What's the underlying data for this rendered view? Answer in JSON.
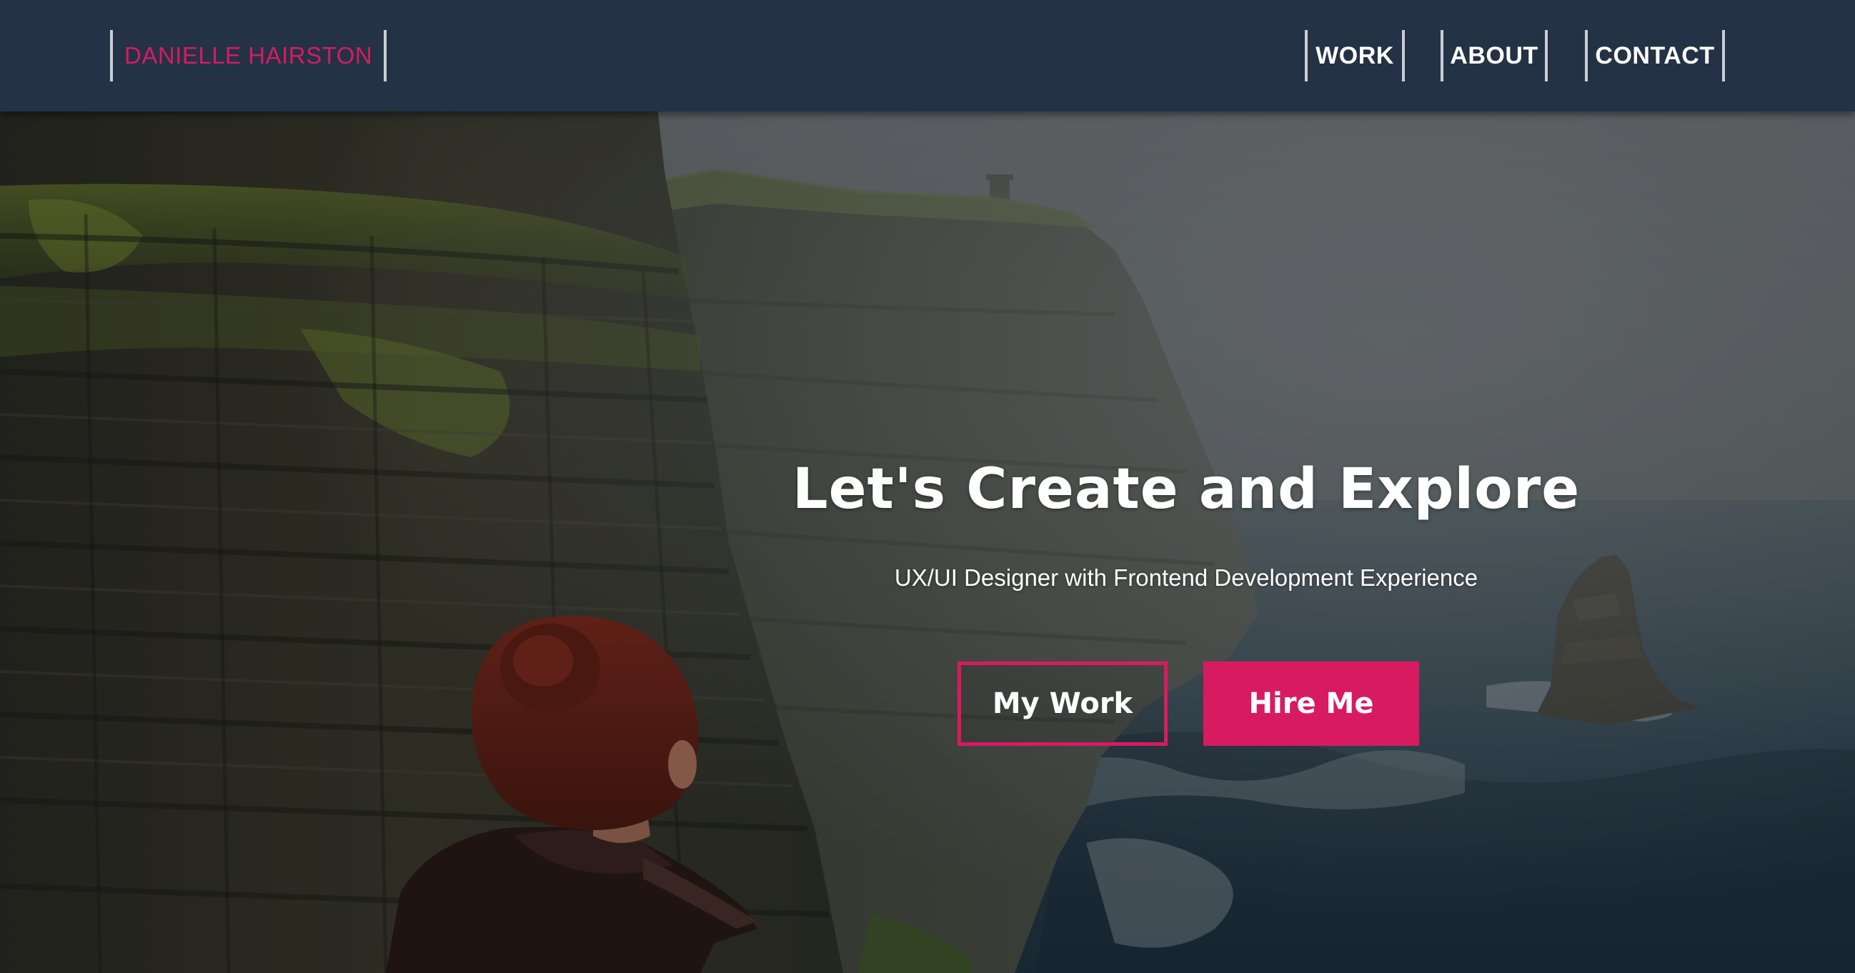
{
  "navbar": {
    "brand": "DANIELLE HAIRSTON",
    "links": [
      {
        "label": "WORK"
      },
      {
        "label": "ABOUT"
      },
      {
        "label": "CONTACT"
      }
    ]
  },
  "hero": {
    "title": "Let's Create and Explore",
    "subtitle": "UX/UI Designer with Frontend Development Experience",
    "buttons": {
      "primary_outline": "My Work",
      "primary_filled": "Hire Me"
    }
  },
  "colors": {
    "accent": "#d81b60",
    "navbar": "#233245",
    "text": "#ffffff"
  }
}
